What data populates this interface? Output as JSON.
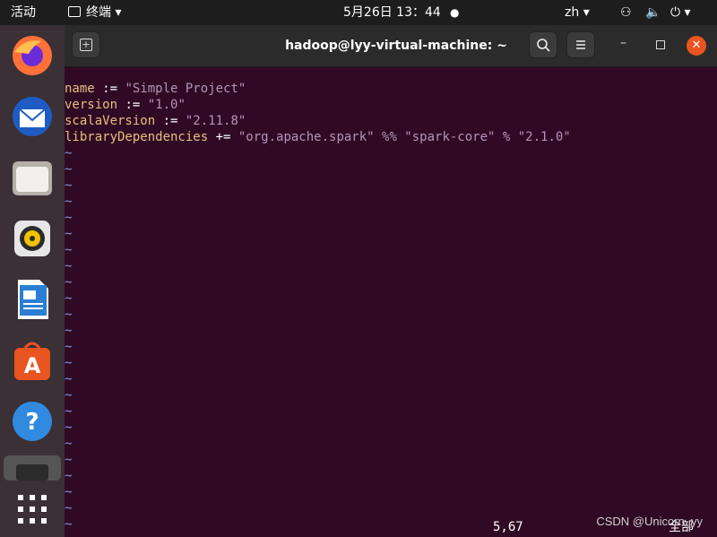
{
  "topbar": {
    "activities": "活动",
    "app_name": "终端",
    "clock": "5月26日 13：44",
    "lang": "zh"
  },
  "dock": {
    "apps": [
      "firefox-icon",
      "thunderbird-icon",
      "files-icon",
      "rhythmbox-icon",
      "libreoffice-writer-icon",
      "software-icon",
      "help-icon",
      "terminal-icon",
      "show-apps-icon"
    ]
  },
  "window": {
    "title": "hadoop@lyy-virtual-machine: ~"
  },
  "editor": {
    "lines": [
      {
        "k": "name",
        "op": " := ",
        "v": "\"Simple Project\""
      },
      {
        "k": "version",
        "op": " := ",
        "v": "\"1.0\""
      },
      {
        "k": "scalaVersion",
        "op": " := ",
        "v": "\"2.11.8\""
      },
      {
        "k": "libraryDependencies",
        "op": " += ",
        "v": "\"org.apache.spark\" %% \"spark-core\" % \"2.1.0\""
      }
    ],
    "tilde": "~",
    "cursor_pos": "5,67",
    "view_pos": "全部"
  },
  "watermark": "CSDN @Unicorn_yy",
  "colors": {
    "terminal_bg": "#300a24",
    "keyword": "#e5c07b",
    "string": "#b294bb",
    "tilde": "#8a8fe0"
  }
}
